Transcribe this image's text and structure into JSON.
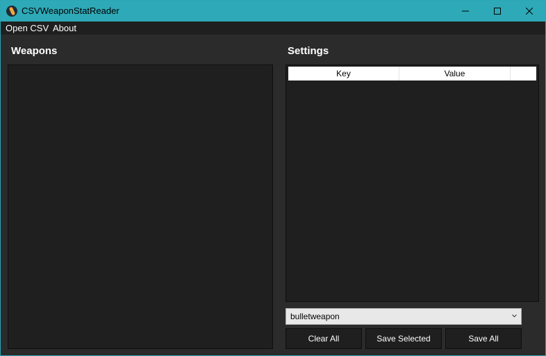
{
  "window": {
    "title": "CSVWeaponStatReader",
    "app_icon": "app-icon",
    "controls": {
      "minimize_icon": "minimize-icon",
      "maximize_icon": "maximize-icon",
      "close_icon": "close-icon"
    }
  },
  "menu": {
    "items": [
      {
        "label": "Open CSV"
      },
      {
        "label": "About"
      }
    ]
  },
  "weapons": {
    "heading": "Weapons",
    "items": []
  },
  "settings": {
    "heading": "Settings",
    "columns": [
      {
        "label": "Key"
      },
      {
        "label": "Value"
      }
    ],
    "rows": []
  },
  "type_select": {
    "value": "bulletweapon",
    "icon": "chevron-down-icon"
  },
  "buttons": {
    "clear_all": "Clear All",
    "save_selected": "Save Selected",
    "save_all": "Save All"
  },
  "colors": {
    "titlebar": "#2ea9b7",
    "background": "#2b2b2b",
    "panel": "#1f1f1f",
    "text": "#ffffff"
  }
}
